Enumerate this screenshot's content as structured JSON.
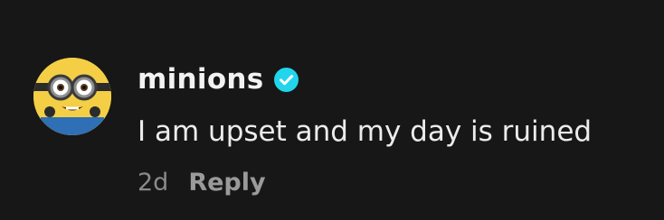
{
  "comment": {
    "username": "minions",
    "verified_icon": "verified-badge-icon",
    "text": "I am upset and my day is ruined",
    "timestamp": "2d",
    "reply_label": "Reply",
    "avatar_icon": "minion-avatar",
    "colors": {
      "background": "#171717",
      "username": "#f2f2f2",
      "text": "#ececec",
      "meta": "#8a8a8a",
      "verified": "#20d5ec"
    }
  }
}
